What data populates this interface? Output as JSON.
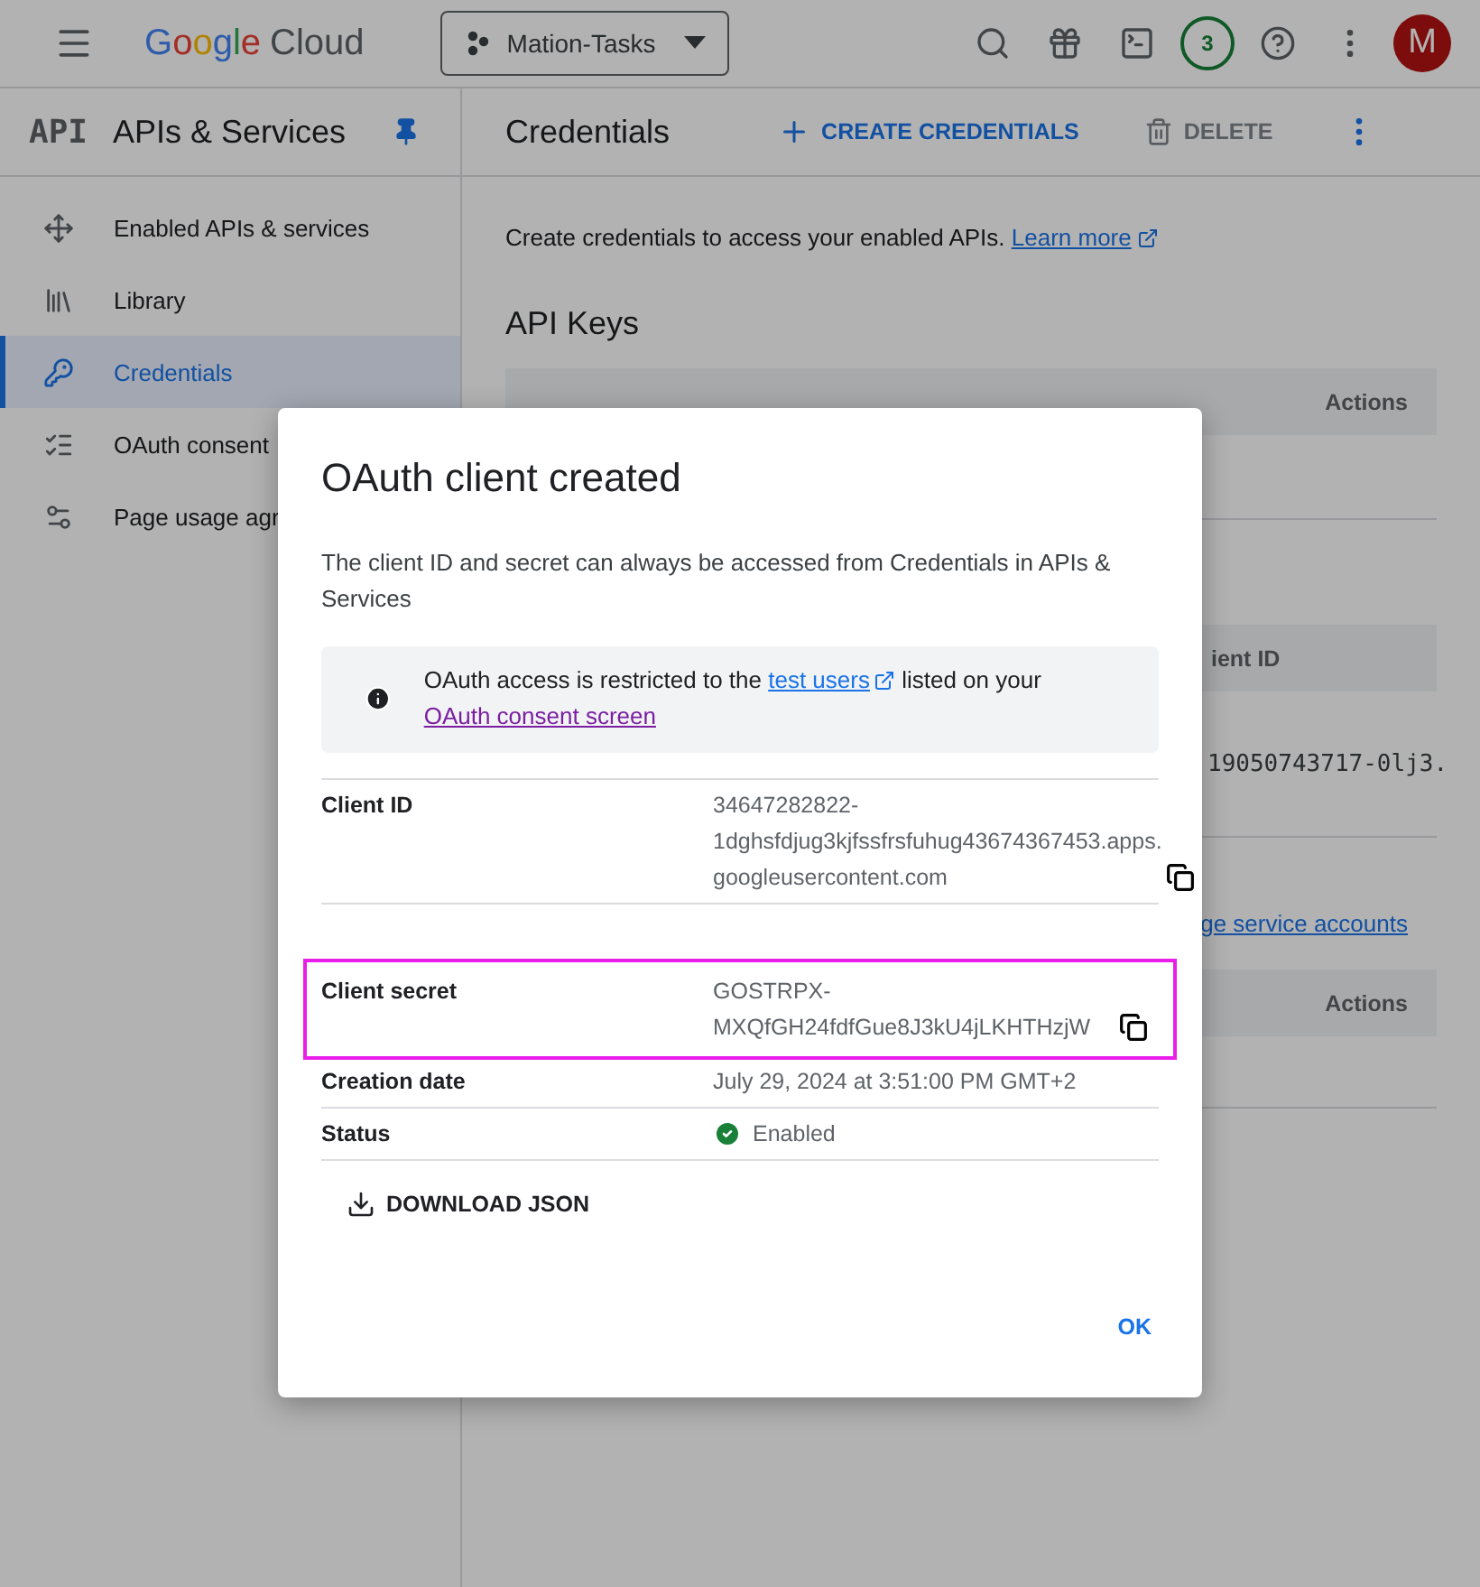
{
  "topbar": {
    "brand": "Google",
    "product": "Cloud",
    "project": "Mation-Tasks",
    "notifications": "3",
    "avatar": "M"
  },
  "sidebar": {
    "logo": "API",
    "title": "APIs & Services",
    "items": [
      {
        "label": "Enabled APIs & services",
        "selected": false
      },
      {
        "label": "Library",
        "selected": false
      },
      {
        "label": "Credentials",
        "selected": true
      },
      {
        "label": "OAuth consent",
        "selected": false
      },
      {
        "label": "Page usage agr",
        "selected": false
      }
    ]
  },
  "page": {
    "title": "Credentials",
    "create": "CREATE CREDENTIALS",
    "delete": "DELETE",
    "intro": "Create credentials to access your enabled APIs.",
    "learn_more": "Learn more",
    "api_keys_title": "API Keys"
  },
  "background": {
    "api_keys_actions": "Actions",
    "oauth_column": "ient ID",
    "oauth_client_id": "19050743717-0lj3.",
    "service_link": "ge service accounts",
    "service_actions": "Actions"
  },
  "dialog": {
    "title": "OAuth client created",
    "description": "The client ID and secret can always be accessed from Credentials in APIs & Services",
    "notice": {
      "before": "OAuth access is restricted to the",
      "link": "test users",
      "after": "listed on your",
      "link2": "OAuth consent screen"
    },
    "fields": [
      {
        "kind": "copy",
        "label": "Client ID",
        "lines": [
          "34647282822-",
          "1dghsfdjug3kjfssfrsfuhug43674367453.apps.",
          "googleusercontent.com"
        ],
        "highlighted": false
      },
      {
        "kind": "copy",
        "label": "Client secret",
        "lines": [
          "GOSTRPX-",
          "MXQfGH24fdfGue8J3kU4jLKHTHzjW"
        ],
        "highlighted": true
      },
      {
        "kind": "text",
        "label": "Creation date",
        "lines": [
          "July 29, 2024 at 3:51:00 PM GMT+2"
        ],
        "highlighted": false
      },
      {
        "kind": "status",
        "label": "Status",
        "lines": [
          "Enabled"
        ],
        "highlighted": false
      }
    ],
    "download": "DOWNLOAD JSON",
    "ok": "OK"
  }
}
